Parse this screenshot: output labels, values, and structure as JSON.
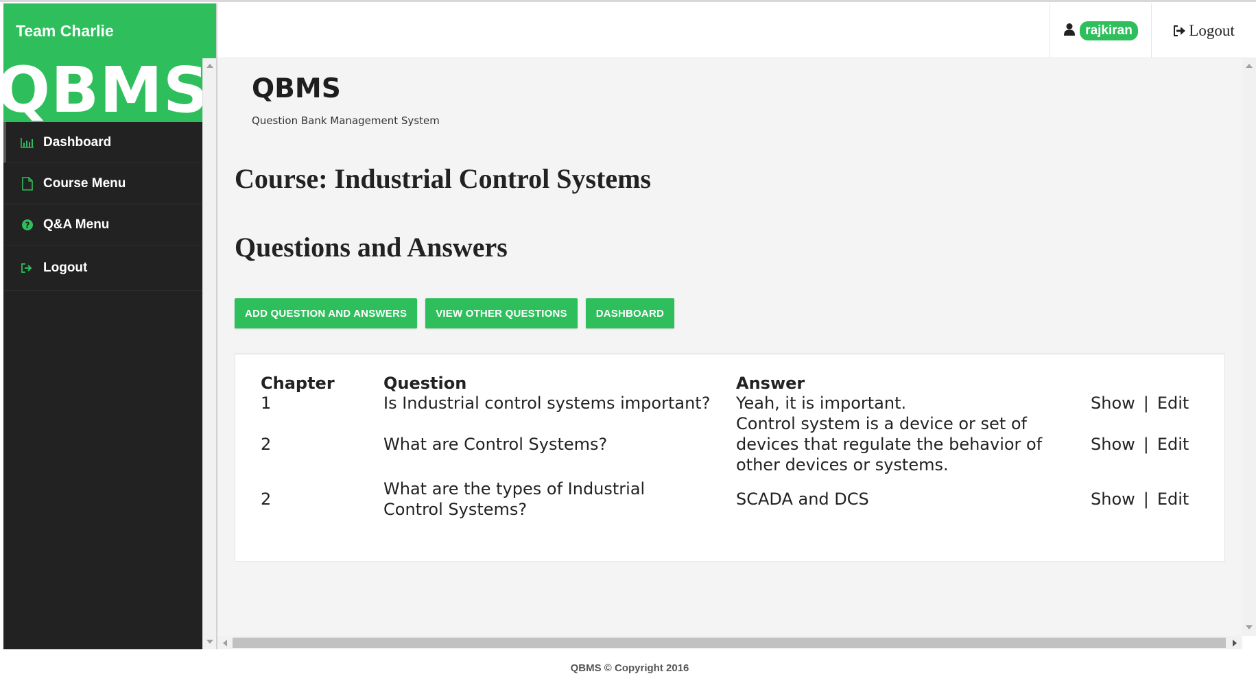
{
  "brand": {
    "name": "Team Charlie",
    "logo_text": "QBMS"
  },
  "colors": {
    "accent": "#2ebf5c",
    "sidebar_bg": "#222222",
    "content_bg": "#f4f4f4"
  },
  "sidebar": {
    "items": [
      {
        "label": "Dashboard",
        "icon": "bar-chart-icon"
      },
      {
        "label": "Course Menu",
        "icon": "file-icon"
      },
      {
        "label": "Q&A Menu",
        "icon": "question-circle-icon"
      },
      {
        "label": "Logout",
        "icon": "sign-out-icon"
      }
    ]
  },
  "header": {
    "username": "rajkiran",
    "logout_label": "Logout"
  },
  "main": {
    "title": "QBMS",
    "subtitle": "Question Bank Management System",
    "course_heading": "Course: Industrial Control Systems",
    "section_heading": "Questions and Answers",
    "buttons": {
      "add": "ADD QUESTION AND ANSWERS",
      "view_other": "VIEW OTHER QUESTIONS",
      "dashboard": "DASHBOARD"
    },
    "table": {
      "headers": {
        "chapter": "Chapter",
        "question": "Question",
        "answer": "Answer"
      },
      "rows": [
        {
          "chapter": "1",
          "question": "Is Industrial control systems important?",
          "answer": "Yeah, it is important.",
          "show": "Show",
          "sep": "|",
          "edit": "Edit"
        },
        {
          "chapter": "2",
          "question": "What are Control Systems?",
          "answer": "Control system is a device or set of devices that regulate the behavior of other devices or systems.",
          "show": "Show",
          "sep": "|",
          "edit": "Edit"
        },
        {
          "chapter": "2",
          "question": "What are the types of Industrial Control Systems?",
          "answer": "SCADA and DCS",
          "show": "Show",
          "sep": "|",
          "edit": "Edit"
        }
      ]
    }
  },
  "footer": {
    "text": "QBMS © Copyright 2016"
  }
}
